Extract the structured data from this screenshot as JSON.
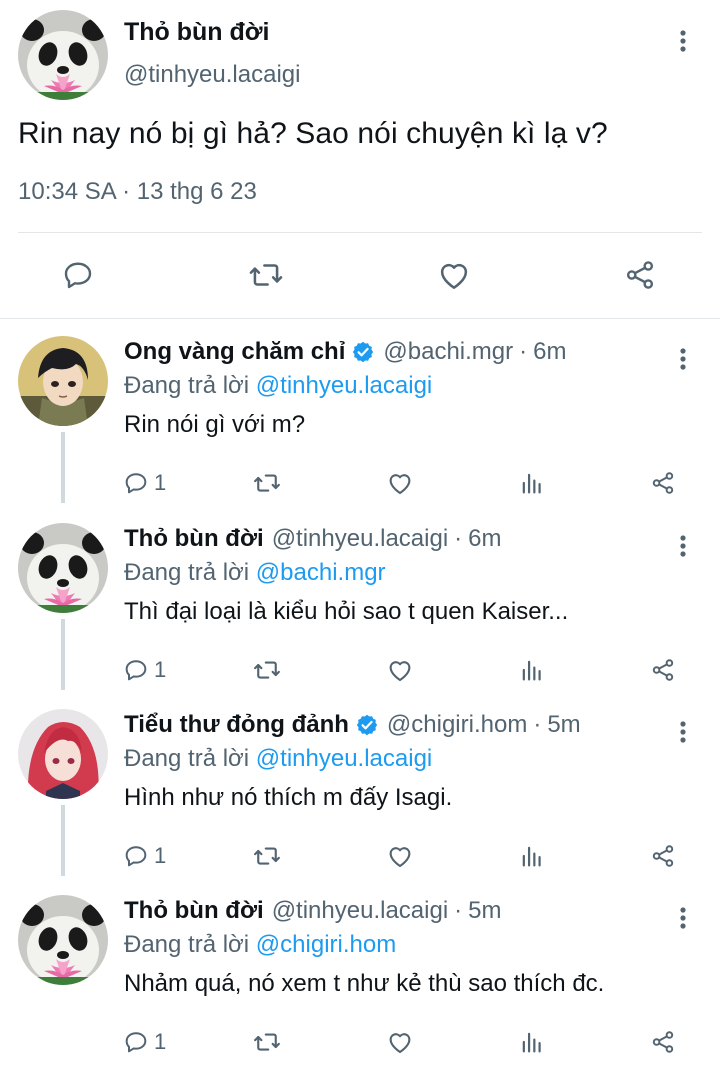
{
  "main_tweet": {
    "author_name": "Thỏ bùn đời",
    "author_handle": "@tinhyeu.lacaigi",
    "text": "Rin nay nó bị gì hả? Sao nói chuyện kì lạ v?",
    "meta": "10:34 SA · 13 thg 6 23",
    "actions": [
      "reply-icon",
      "retweet-icon",
      "like-icon",
      "share-icon"
    ]
  },
  "replies": [
    {
      "name": "Ong vàng chăm chỉ",
      "verified": true,
      "handle": "@bachi.mgr",
      "time": "6m",
      "replying_prefix": "Đang trả lời ",
      "replying_to": "@tinhyeu.lacaigi",
      "text": "Rin nói gì với m?",
      "reply_count": "1",
      "avatar": "anime-boy-avatar"
    },
    {
      "name": "Thỏ bùn đời",
      "verified": false,
      "handle": "@tinhyeu.lacaigi",
      "time": "6m",
      "replying_prefix": "Đang trả lời ",
      "replying_to": "@bachi.mgr",
      "text": "Thì đại loại là kiểu hỏi sao t quen Kaiser...",
      "reply_count": "1",
      "avatar": "panda-avatar"
    },
    {
      "name": "Tiểu thư đỏng đảnh",
      "verified": true,
      "handle": "@chigiri.hom",
      "time": "5m",
      "replying_prefix": "Đang trả lời ",
      "replying_to": "@tinhyeu.lacaigi",
      "text": "Hình như nó thích m đấy Isagi.",
      "reply_count": "1",
      "avatar": "red-hair-avatar"
    },
    {
      "name": "Thỏ bùn đời",
      "verified": false,
      "handle": "@tinhyeu.lacaigi",
      "time": "5m",
      "replying_prefix": "Đang trả lời ",
      "replying_to": "@chigiri.hom",
      "text": "Nhảm quá, nó xem t như kẻ thù sao thích đc.",
      "reply_count": "1",
      "avatar": "panda-avatar"
    }
  ],
  "colors": {
    "text": "#0f1419",
    "secondary": "#536471",
    "link": "#1d9bf0",
    "divider": "#e3e7ea"
  }
}
